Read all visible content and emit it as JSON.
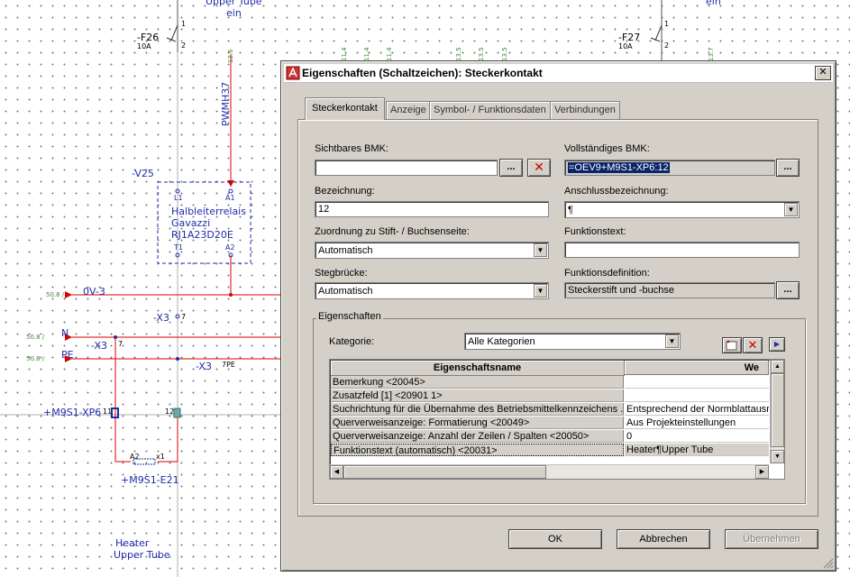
{
  "schematic": {
    "top_labels": [
      "Upper Tube",
      "ein",
      "ein"
    ],
    "fuse_left": {
      "name": "-F26",
      "rating": "10A",
      "pin1": "1",
      "pin2": "2"
    },
    "fuse_right": {
      "name": "-F27",
      "rating": "10A",
      "pin1": "1",
      "pin2": "2"
    },
    "pwm_label": "PWMH37",
    "pwm_ref": "12.6",
    "ref_marks": [
      "11.4",
      "11.4",
      "11.4",
      "13.5",
      "13.5",
      "13.5",
      "13.7"
    ],
    "relay": {
      "tag": "-V25",
      "line1": "Halbleiterrelais",
      "line2": "Gavazzi",
      "line3": "RJ1A23D20E",
      "pin_l1": "L1",
      "pin_a1": "A1",
      "pin_t1": "T1",
      "pin_a2": "A2"
    },
    "nets": [
      {
        "ref": "50.8 /",
        "name": "0V-3"
      },
      {
        "ref": "50.8 /",
        "name": "N"
      },
      {
        "ref": "50.8 /",
        "name": "PE"
      }
    ],
    "x3_labels": [
      {
        "tag": "-X3",
        "pin": "7"
      },
      {
        "tag": "-X3",
        "pin": "7"
      },
      {
        "tag": "-X3",
        "pin": "7PE"
      }
    ],
    "plug_tag": "+M9S1-XP6",
    "plug_pin1": "11",
    "plug_pin2": "12",
    "heater_tag": "+M9S1-E21",
    "heater_pin_a": "A2",
    "heater_pin_b": "x1",
    "heater_line1": "Heater",
    "heater_line2": "Upper Tube"
  },
  "dialog": {
    "title": "Eigenschaften (Schaltzeichen): Steckerkontakt",
    "close": "✕",
    "tabs": [
      "Steckerkontakt",
      "Anzeige",
      "Symbol- / Funktionsdaten",
      "Verbindungen"
    ],
    "fields": {
      "sichtbares_bmk_label": "Sichtbares BMK:",
      "sichtbares_bmk_value": "",
      "vollstaendiges_bmk_label": "Vollständiges BMK:",
      "vollstaendiges_bmk_value": "=OEV9+M9S1-XP6:12",
      "bezeichnung_label": "Bezeichnung:",
      "bezeichnung_value": "12",
      "anschluss_label": "Anschlussbezeichnung:",
      "anschluss_value": "¶",
      "zuordnung_label": "Zuordnung zu Stift- / Buchsenseite:",
      "zuordnung_value": "Automatisch",
      "funktionstext_label": "Funktionstext:",
      "funktionstext_value": "",
      "stegbruecke_label": "Stegbrücke:",
      "stegbruecke_value": "Automatisch",
      "funktionsdef_label": "Funktionsdefinition:",
      "funktionsdef_value": "Steckerstift und -buchse"
    },
    "ellipsis": "...",
    "group_title": "Eigenschaften",
    "kategorie_label": "Kategorie:",
    "kategorie_value": "Alle Kategorien",
    "grid": {
      "col_name": "Eigenschaftsname",
      "col_value": "We",
      "rows": [
        {
          "name": "Bemerkung <20045>",
          "value": ""
        },
        {
          "name": "Zusatzfeld [1] <20901 1>",
          "value": ""
        },
        {
          "name": "Suchrichtung für die Übernahme des Betriebsmittelkennzeichens ...",
          "value": "Entsprechend der Normblattausr"
        },
        {
          "name": "Querverweisanzeige: Formatierung <20049>",
          "value": "Aus Projekteinstellungen"
        },
        {
          "name": "Querverweisanzeige: Anzahl der Zeilen / Spalten <20050>",
          "value": "0"
        },
        {
          "name": "Funktionstext (automatisch) <20031>",
          "value": "Heater¶Upper Tube"
        }
      ]
    },
    "buttons": {
      "ok": "OK",
      "cancel": "Abbrechen",
      "apply": "Übernehmen"
    }
  }
}
